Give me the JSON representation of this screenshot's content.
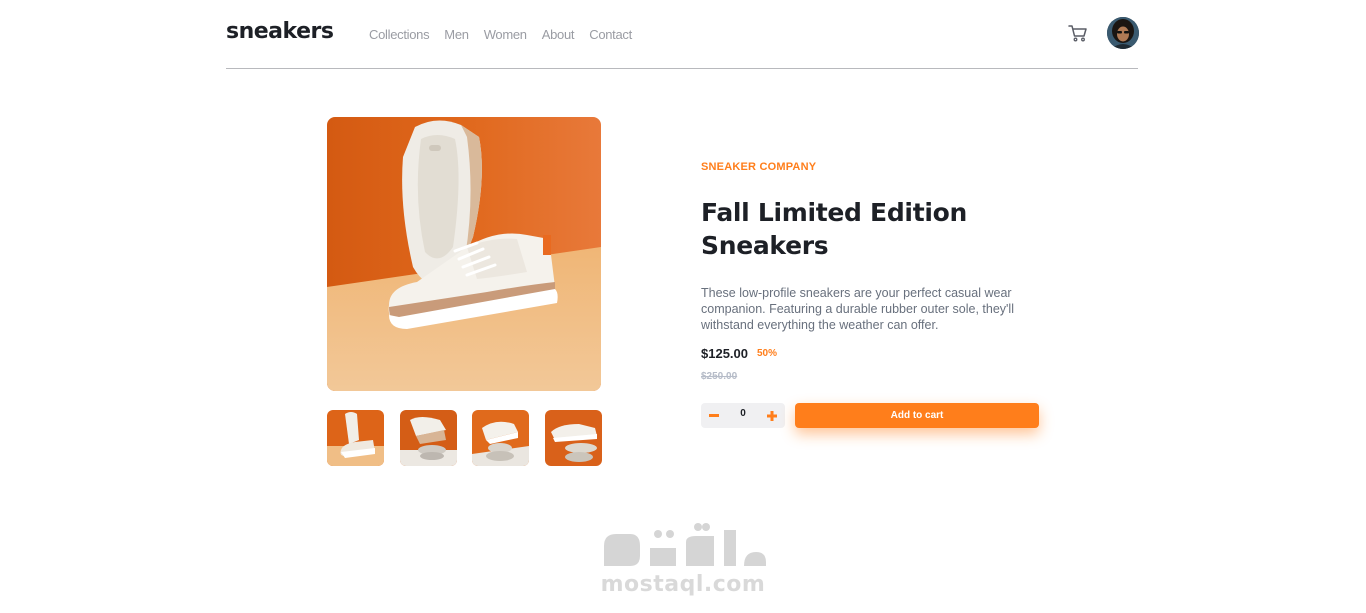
{
  "header": {
    "logo": "sneakers",
    "nav": [
      "Collections",
      "Men",
      "Women",
      "About",
      "Contact"
    ],
    "cart_icon": "cart-icon",
    "avatar_icon": "avatar"
  },
  "gallery": {
    "main_image": "white-beige-sneakers-on-orange-background",
    "thumbnails": [
      "sneakers-thumbnail-1",
      "sneakers-thumbnail-2",
      "sneakers-thumbnail-3",
      "sneakers-thumbnail-4"
    ]
  },
  "product": {
    "company": "SNEAKER COMPANY",
    "title": "Fall Limited Edition Sneakers",
    "description": "These low-profile sneakers are your perfect casual wear companion. Featuring a durable rubber outer sole, they'll withstand everything the weather can offer.",
    "price": "$125.00",
    "discount": "50%",
    "original_price": "$250.00"
  },
  "quantity": {
    "minus": "−",
    "value": "0",
    "plus": "+"
  },
  "actions": {
    "add_to_cart": "Add to cart"
  },
  "watermark": {
    "brand": "mostaql.com"
  },
  "colors": {
    "accent": "#ff7e1b",
    "text_dark": "#1d2026",
    "text_muted": "#68707d",
    "nav_gray": "#9a9ca3"
  }
}
